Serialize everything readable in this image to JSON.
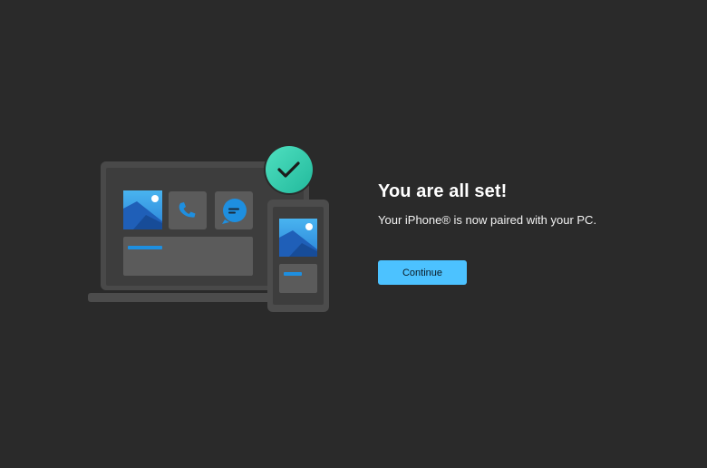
{
  "setup": {
    "title": "You are all set!",
    "message": "Your iPhone® is now paired with your PC.",
    "continue_label": "Continue"
  },
  "illustration": {
    "icons": [
      "photos-icon",
      "phone-call-icon",
      "messages-icon",
      "checkmark-icon"
    ]
  },
  "colors": {
    "background": "#2a2a2a",
    "accent": "#4cc2ff",
    "success": "#3ccfb0",
    "device_frame": "#4a4a4a",
    "tile": "#5b5b5b"
  }
}
